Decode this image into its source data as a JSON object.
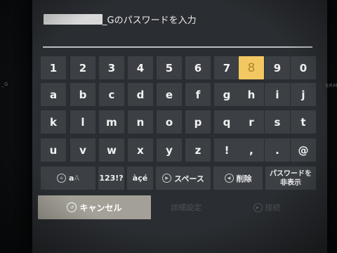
{
  "dialog": {
    "title_suffix": "_Gのパスワードを入力",
    "password_value": ""
  },
  "background": {
    "left_text": "_G",
    "right_text": "ERMI"
  },
  "keyboard": {
    "focused_key": "8",
    "rows": [
      [
        "1",
        "2",
        "3",
        "4",
        "5",
        "6",
        "7",
        "8",
        "9",
        "0"
      ],
      [
        "a",
        "b",
        "c",
        "d",
        "e",
        "f",
        "g",
        "h",
        "i",
        "j"
      ],
      [
        "k",
        "l",
        "m",
        "n",
        "o",
        "p",
        "q",
        "r",
        "s",
        "t"
      ],
      [
        "u",
        "v",
        "w",
        "x",
        "y",
        "z",
        "!",
        ",",
        ".",
        "@"
      ]
    ],
    "function_keys": {
      "case_small": "a",
      "case_big": "A",
      "symbols": "123!?",
      "accents": "àçé",
      "space": "スペース",
      "delete": "削除",
      "hide_password": "パスワードを非表示"
    }
  },
  "buttons": {
    "cancel": "キャンセル",
    "advanced": "詳細設定",
    "connect": "接続"
  },
  "colors": {
    "focus": "#f3c862",
    "key_bg": "#3c4045",
    "cancel_bg": "#a3a197"
  }
}
